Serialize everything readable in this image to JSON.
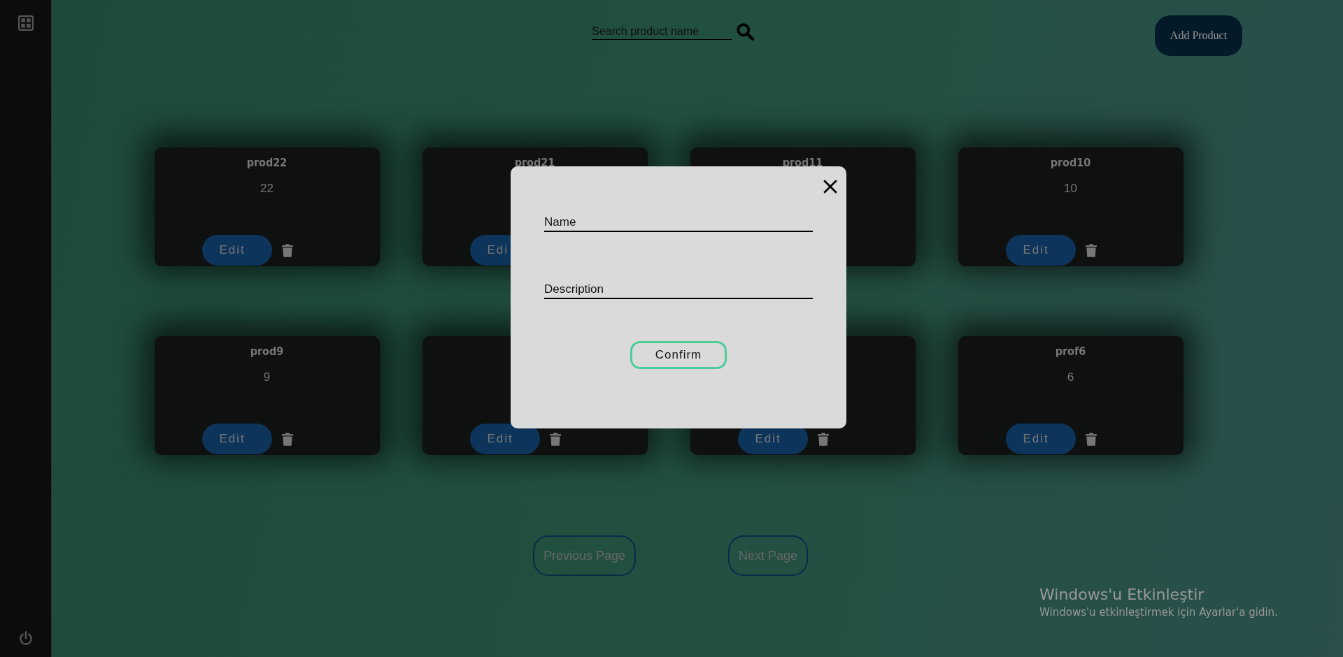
{
  "search": {
    "placeholder": "Search product name"
  },
  "add_button": "Add Product",
  "products": [
    {
      "name": "prod22",
      "value": "22",
      "edit": "Edit",
      "trash": true
    },
    {
      "name": "prod21",
      "edit": "Edi",
      "trash": false
    },
    {
      "name": "prod11",
      "trash": false
    },
    {
      "name": "prod10",
      "value": "10",
      "edit": "Edit",
      "trash": true
    },
    {
      "name": "prod9",
      "value": "9",
      "edit": "Edit",
      "trash": true
    },
    {
      "edit": "Edit",
      "trash": true
    },
    {
      "edit": "Edit",
      "trash": true
    },
    {
      "name": "prof6",
      "value": "6",
      "edit": "Edit",
      "trash": true
    }
  ],
  "pagination": {
    "previous": "Previous Page",
    "next": "Next Page"
  },
  "modal": {
    "fields": [
      {
        "placeholder": "Name"
      },
      {
        "placeholder": "Description"
      }
    ],
    "confirm": "Confirm"
  },
  "os_notice": {
    "title": "Windows'u Etkinleştir",
    "text": "Windows'u etkinleştirmek için Ayarlar'a gidin."
  }
}
